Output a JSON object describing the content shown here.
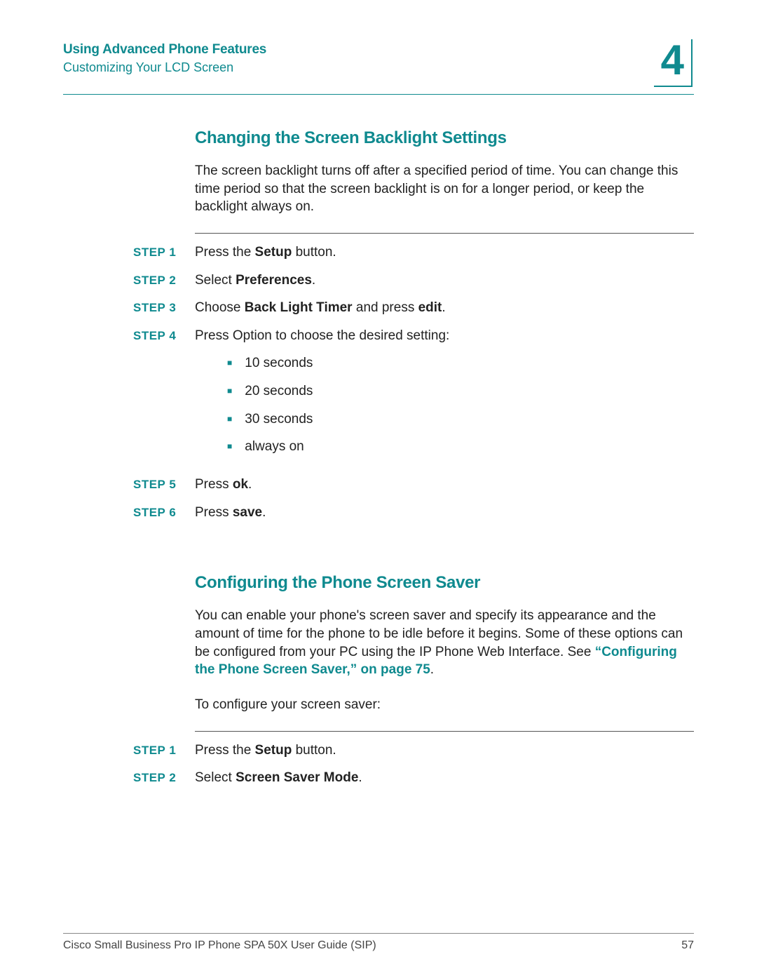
{
  "header": {
    "chapter_title": "Using Advanced Phone Features",
    "section_title": "Customizing Your LCD Screen",
    "chapter_number": "4"
  },
  "section1": {
    "heading": "Changing the Screen Backlight Settings",
    "intro": "The screen backlight turns off after a specified period of time. You can change this time period so that the screen backlight is on for a longer period, or keep the backlight always on.",
    "steps": {
      "s1_label": "STEP 1",
      "s1_pre": "Press the ",
      "s1_bold": "Setup",
      "s1_post": " button.",
      "s2_label": "STEP 2",
      "s2_pre": "Select ",
      "s2_bold": "Preferences",
      "s2_post": ".",
      "s3_label": "STEP 3",
      "s3_pre": "Choose ",
      "s3_bold1": "Back Light Timer",
      "s3_mid": " and press ",
      "s3_bold2": "edit",
      "s3_post": ".",
      "s4_label": "STEP 4",
      "s4_text": "Press Option to choose the desired setting:",
      "s4_opts": {
        "o1": "10 seconds",
        "o2": "20 seconds",
        "o3": "30 seconds",
        "o4": "always on"
      },
      "s5_label": "STEP 5",
      "s5_pre": "Press ",
      "s5_bold": "ok",
      "s5_post": ".",
      "s6_label": "STEP 6",
      "s6_pre": "Press ",
      "s6_bold": "save",
      "s6_post": "."
    }
  },
  "section2": {
    "heading": "Configuring the Phone Screen Saver",
    "intro_pre": "You can enable your phone's screen saver and specify its appearance and the amount of time for the phone to be idle before it begins. Some of these options can be configured from your PC using the IP Phone Web Interface. See ",
    "intro_link": "“Configuring the Phone Screen Saver,” on page 75",
    "intro_post": ".",
    "para2": "To configure your screen saver:",
    "steps": {
      "s1_label": "STEP 1",
      "s1_pre": "Press the ",
      "s1_bold": "Setup",
      "s1_post": " button.",
      "s2_label": "STEP 2",
      "s2_pre": "Select ",
      "s2_bold": "Screen Saver Mode",
      "s2_post": "."
    }
  },
  "footer": {
    "title": "Cisco Small Business Pro IP Phone SPA 50X User Guide (SIP)",
    "page": "57"
  }
}
